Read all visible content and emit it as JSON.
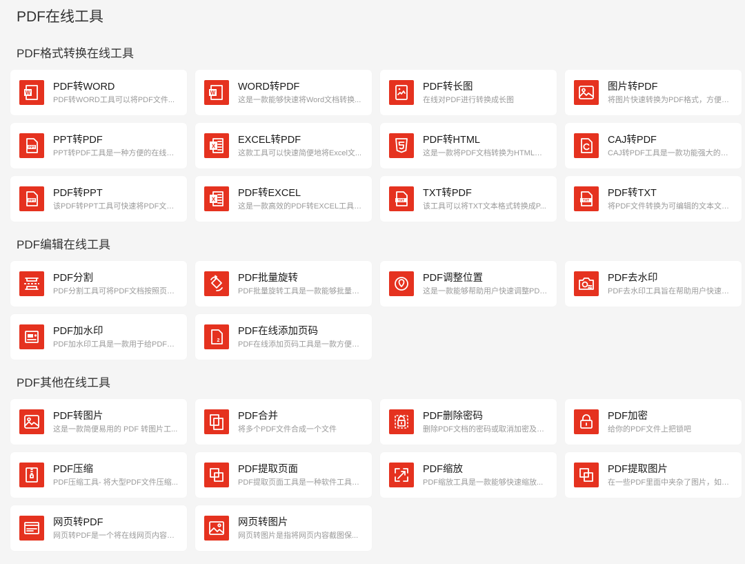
{
  "page": {
    "title": "PDF在线工具"
  },
  "sections": [
    {
      "title": "PDF格式转换在线工具",
      "tools": [
        {
          "name": "PDF转WORD",
          "desc": "PDF转WORD工具可以将PDF文件...",
          "icon": "word-icon"
        },
        {
          "name": "WORD转PDF",
          "desc": "这是一款能够快速将Word文档转换...",
          "icon": "word-icon"
        },
        {
          "name": "PDF转长图",
          "desc": "在线对PDF进行转换成长图",
          "icon": "long-image-icon"
        },
        {
          "name": "图片转PDF",
          "desc": "将图片快速转换为PDF格式，方便存...",
          "icon": "image-icon"
        },
        {
          "name": "PPT转PDF",
          "desc": "PPT转PDF工具是一种方便的在线工...",
          "icon": "ppt-icon"
        },
        {
          "name": "EXCEL转PDF",
          "desc": "这款工具可以快速简便地将Excel文...",
          "icon": "excel-icon"
        },
        {
          "name": "PDF转HTML",
          "desc": "这是一款将PDF文档转换为HTML格...",
          "icon": "html5-icon"
        },
        {
          "name": "CAJ转PDF",
          "desc": "CAJ转PDF工具是一款功能强大的软...",
          "icon": "caj-icon"
        },
        {
          "name": "PDF转PPT",
          "desc": "该PDF转PPT工具可快速将PDF文档...",
          "icon": "ppt-icon"
        },
        {
          "name": "PDF转EXCEL",
          "desc": "这是一款高效的PDF转EXCEL工具，...",
          "icon": "excel-icon"
        },
        {
          "name": "TXT转PDF",
          "desc": "该工具可以将TXT文本格式转换成P...",
          "icon": "txt-icon"
        },
        {
          "name": "PDF转TXT",
          "desc": "将PDF文件转换为可编辑的文本文件...",
          "icon": "txt-icon"
        }
      ]
    },
    {
      "title": "PDF编辑在线工具",
      "tools": [
        {
          "name": "PDF分割",
          "desc": "PDF分割工具可将PDF文档按照页面...",
          "icon": "split-icon"
        },
        {
          "name": "PDF批量旋转",
          "desc": "PDF批量旋转工具是一款能够批量旋...",
          "icon": "rotate-icon"
        },
        {
          "name": "PDF调整位置",
          "desc": "这是一款能够帮助用户快速调整PDF...",
          "icon": "location-icon"
        },
        {
          "name": "PDF去水印",
          "desc": "PDF去水印工具旨在帮助用户快速、...",
          "icon": "watermark-remove-icon"
        },
        {
          "name": "PDF加水印",
          "desc": "PDF加水印工具是一款用于给PDF文...",
          "icon": "watermark-add-icon"
        },
        {
          "name": "PDF在线添加页码",
          "desc": "PDF在线添加页码工具是一款方便快...",
          "icon": "page-number-icon"
        }
      ]
    },
    {
      "title": "PDF其他在线工具",
      "tools": [
        {
          "name": "PDF转图片",
          "desc": "这是一款简便易用的 PDF 转图片工...",
          "icon": "image-icon"
        },
        {
          "name": "PDF合并",
          "desc": "将多个PDF文件合成一个文件",
          "icon": "merge-icon"
        },
        {
          "name": "PDF删除密码",
          "desc": "删除PDF文档的密码或取消加密及权...",
          "icon": "unlock-icon"
        },
        {
          "name": "PDF加密",
          "desc": "给你的PDF文件上把锁吧",
          "icon": "lock-icon"
        },
        {
          "name": "PDF压缩",
          "desc": "PDF压缩工具- 将大型PDF文件压缩...",
          "icon": "compress-icon"
        },
        {
          "name": "PDF提取页面",
          "desc": "PDF提取页面工具是一种软件工具，...",
          "icon": "copy-icon"
        },
        {
          "name": "PDF缩放",
          "desc": "PDF缩放工具是一款能够快速缩放...",
          "icon": "resize-icon"
        },
        {
          "name": "PDF提取图片",
          "desc": "在一些PDF里面中夹杂了图片，如果...",
          "icon": "copy-icon"
        },
        {
          "name": "网页转PDF",
          "desc": "网页转PDF是一个将在线网页内容高...",
          "icon": "browser-icon"
        },
        {
          "name": "网页转图片",
          "desc": "网页转图片是指将网页内容截图保...",
          "icon": "web-image-icon"
        }
      ]
    }
  ],
  "colors": {
    "accent": "#e5321f",
    "background": "#f5f5f5",
    "card": "#ffffff"
  }
}
